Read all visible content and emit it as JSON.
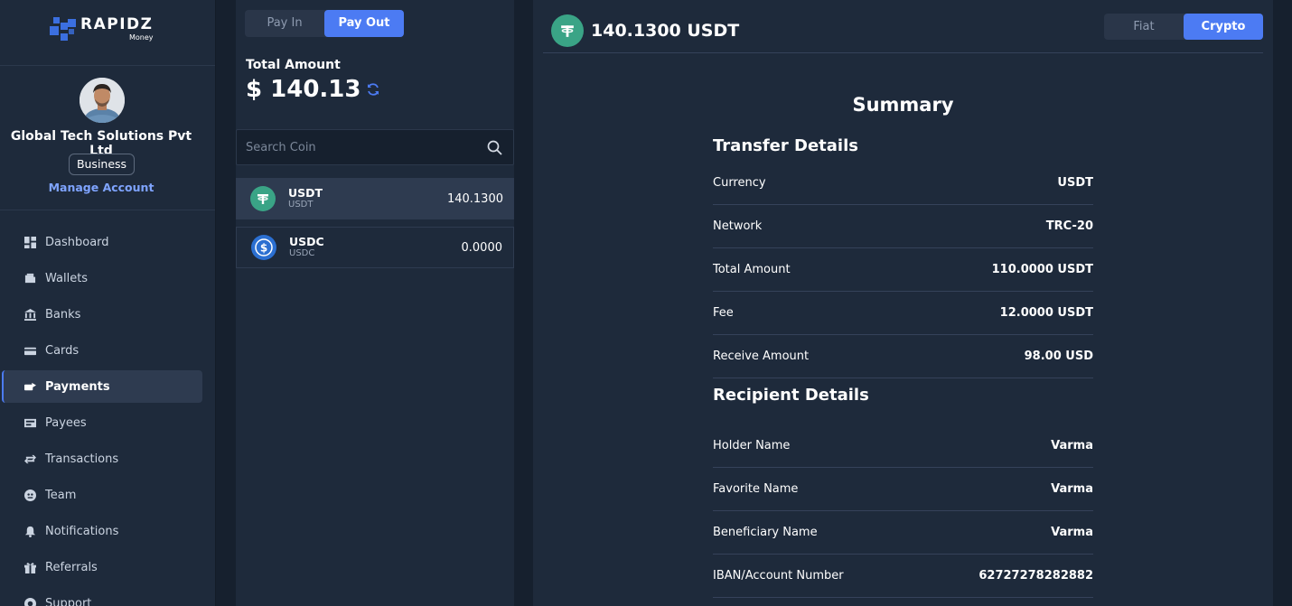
{
  "brand": {
    "name": "RAPIDZ",
    "sub": "Money",
    "color": "#3b6fe0"
  },
  "profile": {
    "company": "Global Tech Solutions Pvt Ltd",
    "badge": "Business",
    "manage_label": "Manage Account"
  },
  "nav": {
    "items": [
      {
        "label": "Dashboard",
        "icon": "dashboard-icon"
      },
      {
        "label": "Wallets",
        "icon": "wallet-icon"
      },
      {
        "label": "Banks",
        "icon": "bank-icon"
      },
      {
        "label": "Cards",
        "icon": "card-icon"
      },
      {
        "label": "Payments",
        "icon": "payments-icon",
        "active": true
      },
      {
        "label": "Payees",
        "icon": "payees-icon"
      },
      {
        "label": "Transactions",
        "icon": "transactions-icon"
      },
      {
        "label": "Team",
        "icon": "team-icon"
      },
      {
        "label": "Notifications",
        "icon": "bell-icon"
      },
      {
        "label": "Referrals",
        "icon": "gift-icon"
      },
      {
        "label": "Support",
        "icon": "support-icon"
      }
    ]
  },
  "wallet_panel": {
    "tabs": {
      "pay_in": "Pay In",
      "pay_out": "Pay Out",
      "active": "pay_out"
    },
    "total_label": "Total Amount",
    "total_amount": "$ 140.13",
    "search_placeholder": "Search Coin",
    "coins": [
      {
        "name": "USDT",
        "sub": "USDT",
        "balance": "140.1300",
        "icon": "tether-icon",
        "color": "#3aa486"
      },
      {
        "name": "USDC",
        "sub": "USDC",
        "balance": "0.0000",
        "icon": "usdc-icon",
        "color": "#2b6fd1"
      }
    ]
  },
  "detail_panel": {
    "header_amount": "140.1300 USDT",
    "mode_tabs": {
      "fiat": "Fiat",
      "crypto": "Crypto",
      "active": "crypto"
    },
    "summary_title": "Summary",
    "transfer_title": "Transfer Details",
    "transfer_rows": [
      {
        "label": "Currency",
        "value": "USDT"
      },
      {
        "label": "Network",
        "value": "TRC-20"
      },
      {
        "label": "Total Amount",
        "value": "110.0000 USDT"
      },
      {
        "label": "Fee",
        "value": "12.0000 USDT"
      },
      {
        "label": "Receive Amount",
        "value": "98.00 USD"
      }
    ],
    "recipient_title": "Recipient Details",
    "recipient_rows": [
      {
        "label": "Holder Name",
        "value": "Varma"
      },
      {
        "label": "Favorite Name",
        "value": "Varma"
      },
      {
        "label": "Beneficiary Name",
        "value": "Varma"
      },
      {
        "label": "IBAN/Account Number",
        "value": "62727278282882"
      }
    ]
  },
  "colors": {
    "accent": "#4c7bf3",
    "link": "#7fa4ff",
    "panel": "#1e2a3b",
    "background": "#16202e"
  }
}
